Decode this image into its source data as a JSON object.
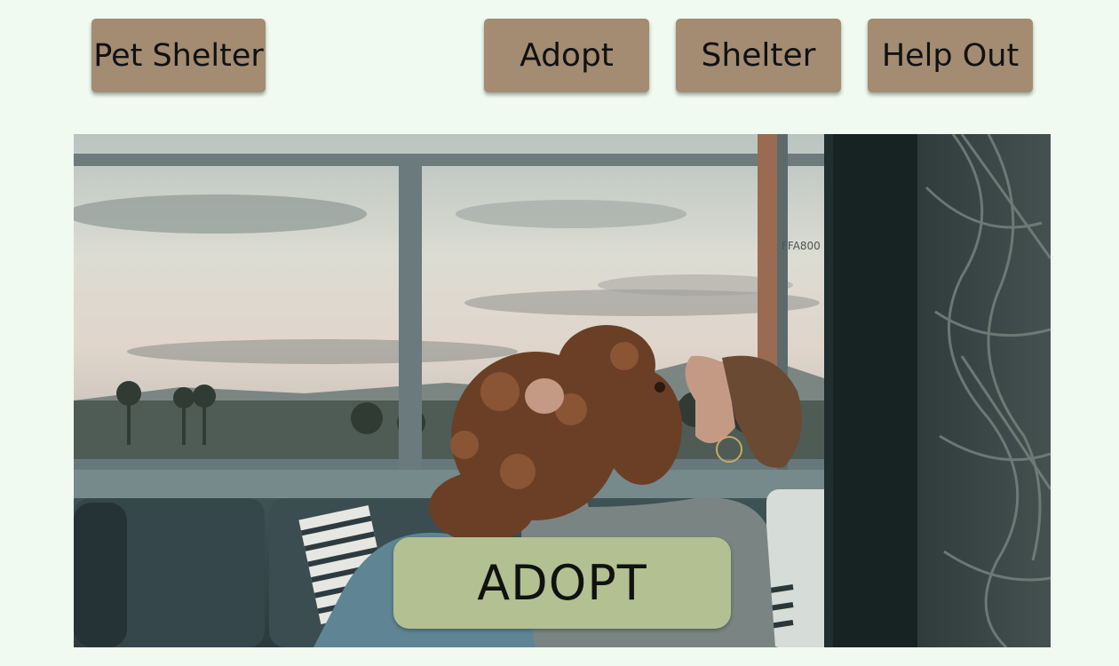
{
  "header": {
    "brand_label": "Pet Shelter",
    "nav": {
      "adopt_label": "Adopt",
      "shelter_label": "Shelter",
      "help_label": "Help Out"
    }
  },
  "hero": {
    "cta_label": "ADOPT",
    "overlay_text": "FFA800"
  },
  "colors": {
    "page_background": "#f1faf0",
    "nav_button": "#a38c72",
    "cta_button": "#b2c092"
  }
}
